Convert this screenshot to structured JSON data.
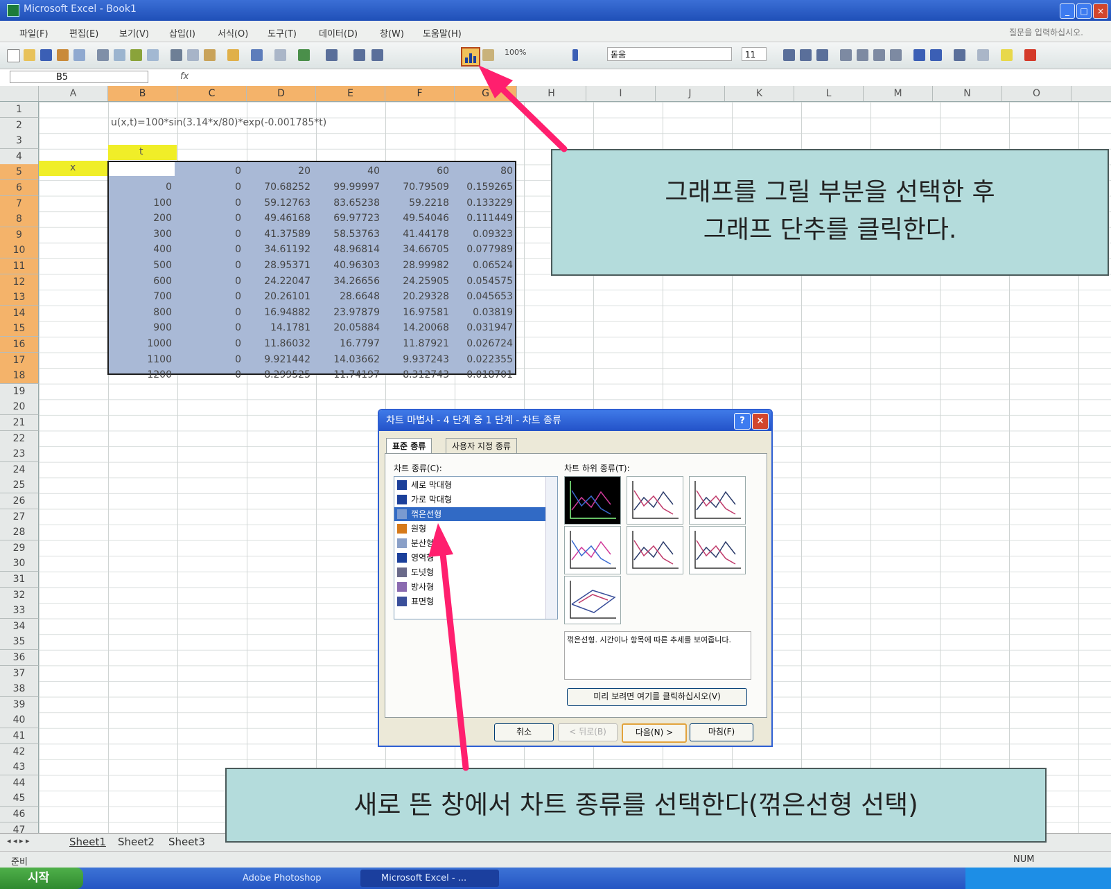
{
  "window": {
    "title": "Microsoft Excel - Book1"
  },
  "menu": {
    "items": [
      "파일(F)",
      "편집(E)",
      "보기(V)",
      "삽입(I)",
      "서식(O)",
      "도구(T)",
      "데이터(D)",
      "창(W)",
      "도움말(H)"
    ],
    "help_box": "질문을 입력하십시오."
  },
  "toolbar": {
    "zoom": "100%",
    "font_name": "돋움",
    "font_size": "11"
  },
  "formula_bar": {
    "name_box": "B5",
    "fx": "fx"
  },
  "columns": [
    "A",
    "B",
    "C",
    "D",
    "E",
    "F",
    "G",
    "H",
    "I",
    "J",
    "K",
    "L",
    "M",
    "N",
    "O"
  ],
  "rows": [
    "1",
    "2",
    "3",
    "4",
    "5",
    "6",
    "7",
    "8",
    "9",
    "10",
    "11",
    "12",
    "13",
    "14",
    "15",
    "16",
    "17",
    "18",
    "19",
    "20",
    "21",
    "22",
    "23",
    "24",
    "25",
    "26",
    "27",
    "28",
    "29",
    "30",
    "31",
    "32",
    "33",
    "34",
    "35",
    "36",
    "37",
    "38",
    "39",
    "40",
    "41",
    "42",
    "43",
    "44",
    "45",
    "46",
    "47"
  ],
  "sheet": {
    "formula_text": "u(x,t)=100*sin(3.14*x/80)*exp(-0.001785*t)",
    "t_label": "t",
    "x_label": "x",
    "header_row": [
      "0",
      "20",
      "40",
      "60",
      "80"
    ],
    "data": [
      [
        "0",
        "0",
        "70.68252",
        "99.99997",
        "70.79509",
        "0.159265"
      ],
      [
        "100",
        "0",
        "59.12763",
        "83.65238",
        "59.2218",
        "0.133229"
      ],
      [
        "200",
        "0",
        "49.46168",
        "69.97723",
        "49.54046",
        "0.111449"
      ],
      [
        "300",
        "0",
        "41.37589",
        "58.53763",
        "41.44178",
        "0.09323"
      ],
      [
        "400",
        "0",
        "34.61192",
        "48.96814",
        "34.66705",
        "0.077989"
      ],
      [
        "500",
        "0",
        "28.95371",
        "40.96303",
        "28.99982",
        "0.06524"
      ],
      [
        "600",
        "0",
        "24.22047",
        "34.26656",
        "24.25905",
        "0.054575"
      ],
      [
        "700",
        "0",
        "20.26101",
        "28.6648",
        "20.29328",
        "0.045653"
      ],
      [
        "800",
        "0",
        "16.94882",
        "23.97879",
        "16.97581",
        "0.03819"
      ],
      [
        "900",
        "0",
        "14.1781",
        "20.05884",
        "14.20068",
        "0.031947"
      ],
      [
        "1000",
        "0",
        "11.86032",
        "16.7797",
        "11.87921",
        "0.026724"
      ],
      [
        "1100",
        "0",
        "9.921442",
        "14.03662",
        "9.937243",
        "0.022355"
      ],
      [
        "1200",
        "0",
        "8.299525",
        "11.74197",
        "8.312743",
        "0.018701"
      ]
    ]
  },
  "sheet_tabs": [
    "Sheet1",
    "Sheet2",
    "Sheet3"
  ],
  "status": {
    "left": "준비",
    "num": "NUM"
  },
  "taskbar": {
    "start": "시작",
    "tasks": [
      "Adobe Photoshop",
      "Microsoft Excel - ..."
    ]
  },
  "dialog": {
    "title": "차트 마법사 - 4 단계 중 1 단계 - 차트 종류",
    "tabs": [
      "표준 종류",
      "사용자 지정 종류"
    ],
    "chart_type_label": "차트 종류(C):",
    "subtype_label": "차트 하위 종류(T):",
    "chart_types": [
      "세로 막대형",
      "가로 막대형",
      "꺾은선형",
      "원형",
      "분산형",
      "영역형",
      "도넛형",
      "방사형",
      "표면형"
    ],
    "selected_type_index": 2,
    "description": "꺾은선형. 시간이나 항목에 따른 추세를 보여줍니다.",
    "preview_button": "미리 보려면 여기를 클릭하십시오(V)",
    "buttons": {
      "cancel": "취소",
      "back": "< 뒤로(B)",
      "next": "다음(N) >",
      "finish": "마침(F)"
    }
  },
  "callouts": {
    "top": [
      "그래프를 그릴 부분을 선택한 후",
      "그래프 단추를 클릭한다."
    ],
    "bottom": "새로 뜬 창에서 차트 종류를 선택한다(꺾은선형 선택)"
  },
  "colors": {
    "selection": "#a9b9d6",
    "highlight_yellow": "#f0ee28",
    "callout_bg": "#b4dcdc",
    "arrow": "#ff1f6e",
    "header_selected": "#f4b36a"
  }
}
